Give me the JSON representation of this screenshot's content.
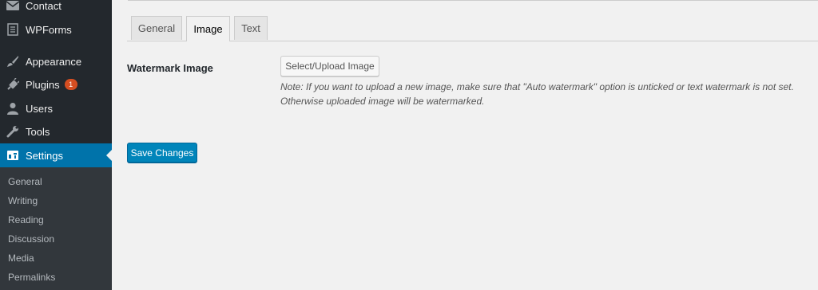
{
  "sidebar": {
    "items": [
      {
        "label": "Contact",
        "icon": "envelope-icon"
      },
      {
        "label": "WPForms",
        "icon": "form-icon"
      },
      {
        "label": "Appearance",
        "icon": "brush-icon"
      },
      {
        "label": "Plugins",
        "icon": "plug-icon",
        "badge": "1"
      },
      {
        "label": "Users",
        "icon": "user-icon"
      },
      {
        "label": "Tools",
        "icon": "wrench-icon"
      },
      {
        "label": "Settings",
        "icon": "settings-icon",
        "current": true
      }
    ],
    "submenu": [
      "General",
      "Writing",
      "Reading",
      "Discussion",
      "Media",
      "Permalinks"
    ]
  },
  "tabs": [
    {
      "label": "General"
    },
    {
      "label": "Image",
      "active": true
    },
    {
      "label": "Text"
    }
  ],
  "form": {
    "field_label": "Watermark Image",
    "upload_button": "Select/Upload Image",
    "note_line1": "Note: If you want to upload a new image, make sure that \"Auto watermark\" option is unticked or text watermark is not set.",
    "note_line2": "Otherwise uploaded image will be watermarked.",
    "save_button": "Save Changes"
  },
  "colors": {
    "sidebar_bg": "#23282d",
    "submenu_bg": "#32373c",
    "accent": "#0073aa",
    "button_primary": "#0085ba",
    "badge": "#d54e21"
  }
}
